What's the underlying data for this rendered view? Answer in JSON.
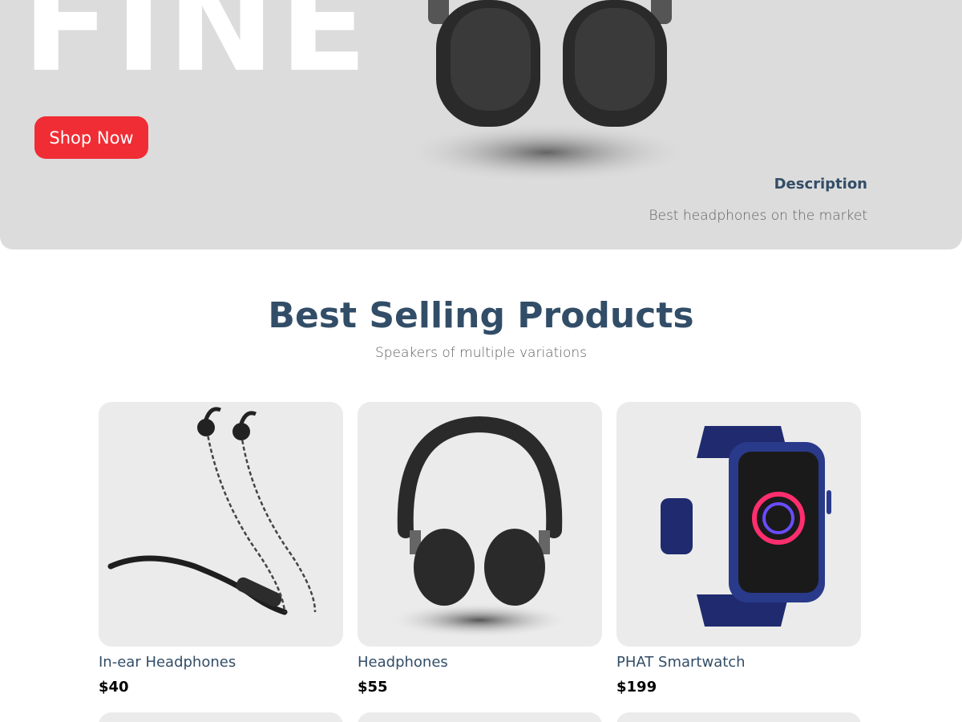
{
  "hero": {
    "big_word": "FINE",
    "button_label": "Shop Now",
    "description_title": "Description",
    "description_text": "Best headphones on the market"
  },
  "section": {
    "title": "Best Selling Products",
    "subtitle": "Speakers of multiple variations"
  },
  "products": [
    {
      "name": "In-ear Headphones",
      "price": "$40"
    },
    {
      "name": "Headphones",
      "price": "$55"
    },
    {
      "name": "PHAT Smartwatch",
      "price": "$199"
    }
  ],
  "colors": {
    "accent": "#f02d34",
    "heading": "#324d67",
    "hero_bg": "#dcdcdc",
    "card_bg": "#ebebeb"
  }
}
